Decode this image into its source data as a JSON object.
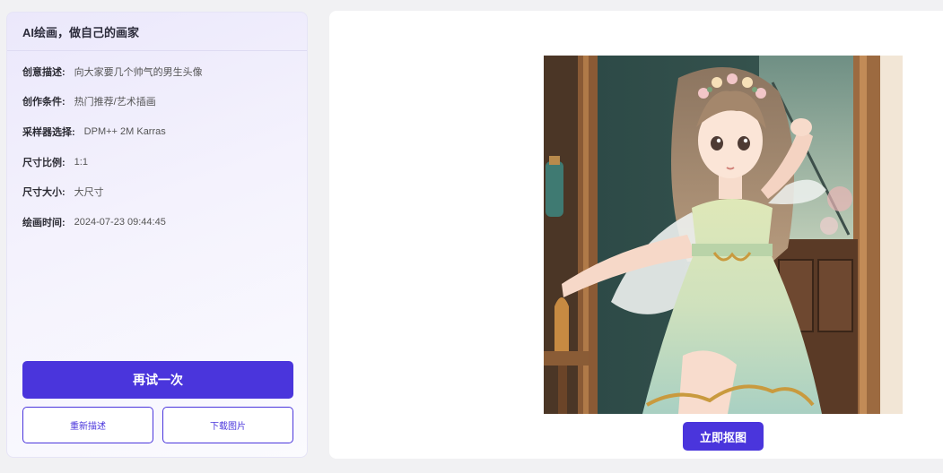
{
  "panel": {
    "title": "AI绘画，做自己的画家",
    "fields": [
      {
        "label": "创意描述:",
        "value": "向大家要几个帅气的男生头像"
      },
      {
        "label": "创作条件:",
        "value": "热门推荐/艺术插画"
      },
      {
        "label": "采样器选择:",
        "value": "DPM++ 2M Karras"
      },
      {
        "label": "尺寸比例:",
        "value": "1:1"
      },
      {
        "label": "尺寸大小:",
        "value": "大尺寸"
      },
      {
        "label": "绘画时间:",
        "value": "2024-07-23 09:44:45"
      }
    ],
    "retry_label": "再试一次",
    "redescribe_label": "重新描述",
    "download_label": "下载图片"
  },
  "preview": {
    "cutout_label": "立即抠图"
  },
  "colors": {
    "accent": "#4a35dc"
  }
}
